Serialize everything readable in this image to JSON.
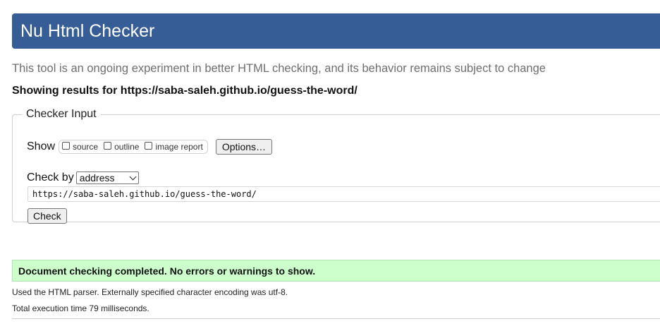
{
  "header": {
    "title": "Nu Html Checker"
  },
  "intro_text": "This tool is an ongoing experiment in better HTML checking, and its behavior remains subject to change",
  "results_heading": "Showing results for https://saba-saleh.github.io/guess-the-word/",
  "checker_input": {
    "legend": "Checker Input",
    "show_label": "Show",
    "show_options": [
      {
        "label": "source",
        "checked": false
      },
      {
        "label": "outline",
        "checked": false
      },
      {
        "label": "image report",
        "checked": false
      }
    ],
    "options_button": "Options…",
    "check_by_label": "Check by",
    "check_by_value": "address",
    "url_value": "https://saba-saleh.github.io/guess-the-word/",
    "check_button": "Check"
  },
  "result": {
    "message": "Document checking completed. No errors or warnings to show.",
    "status_color": "#ccffcc",
    "parser_info": "Used the HTML parser. Externally specified character encoding was utf-8.",
    "execution_time": "Total execution time 79 milliseconds."
  },
  "colors": {
    "header_bg": "#365d95"
  }
}
